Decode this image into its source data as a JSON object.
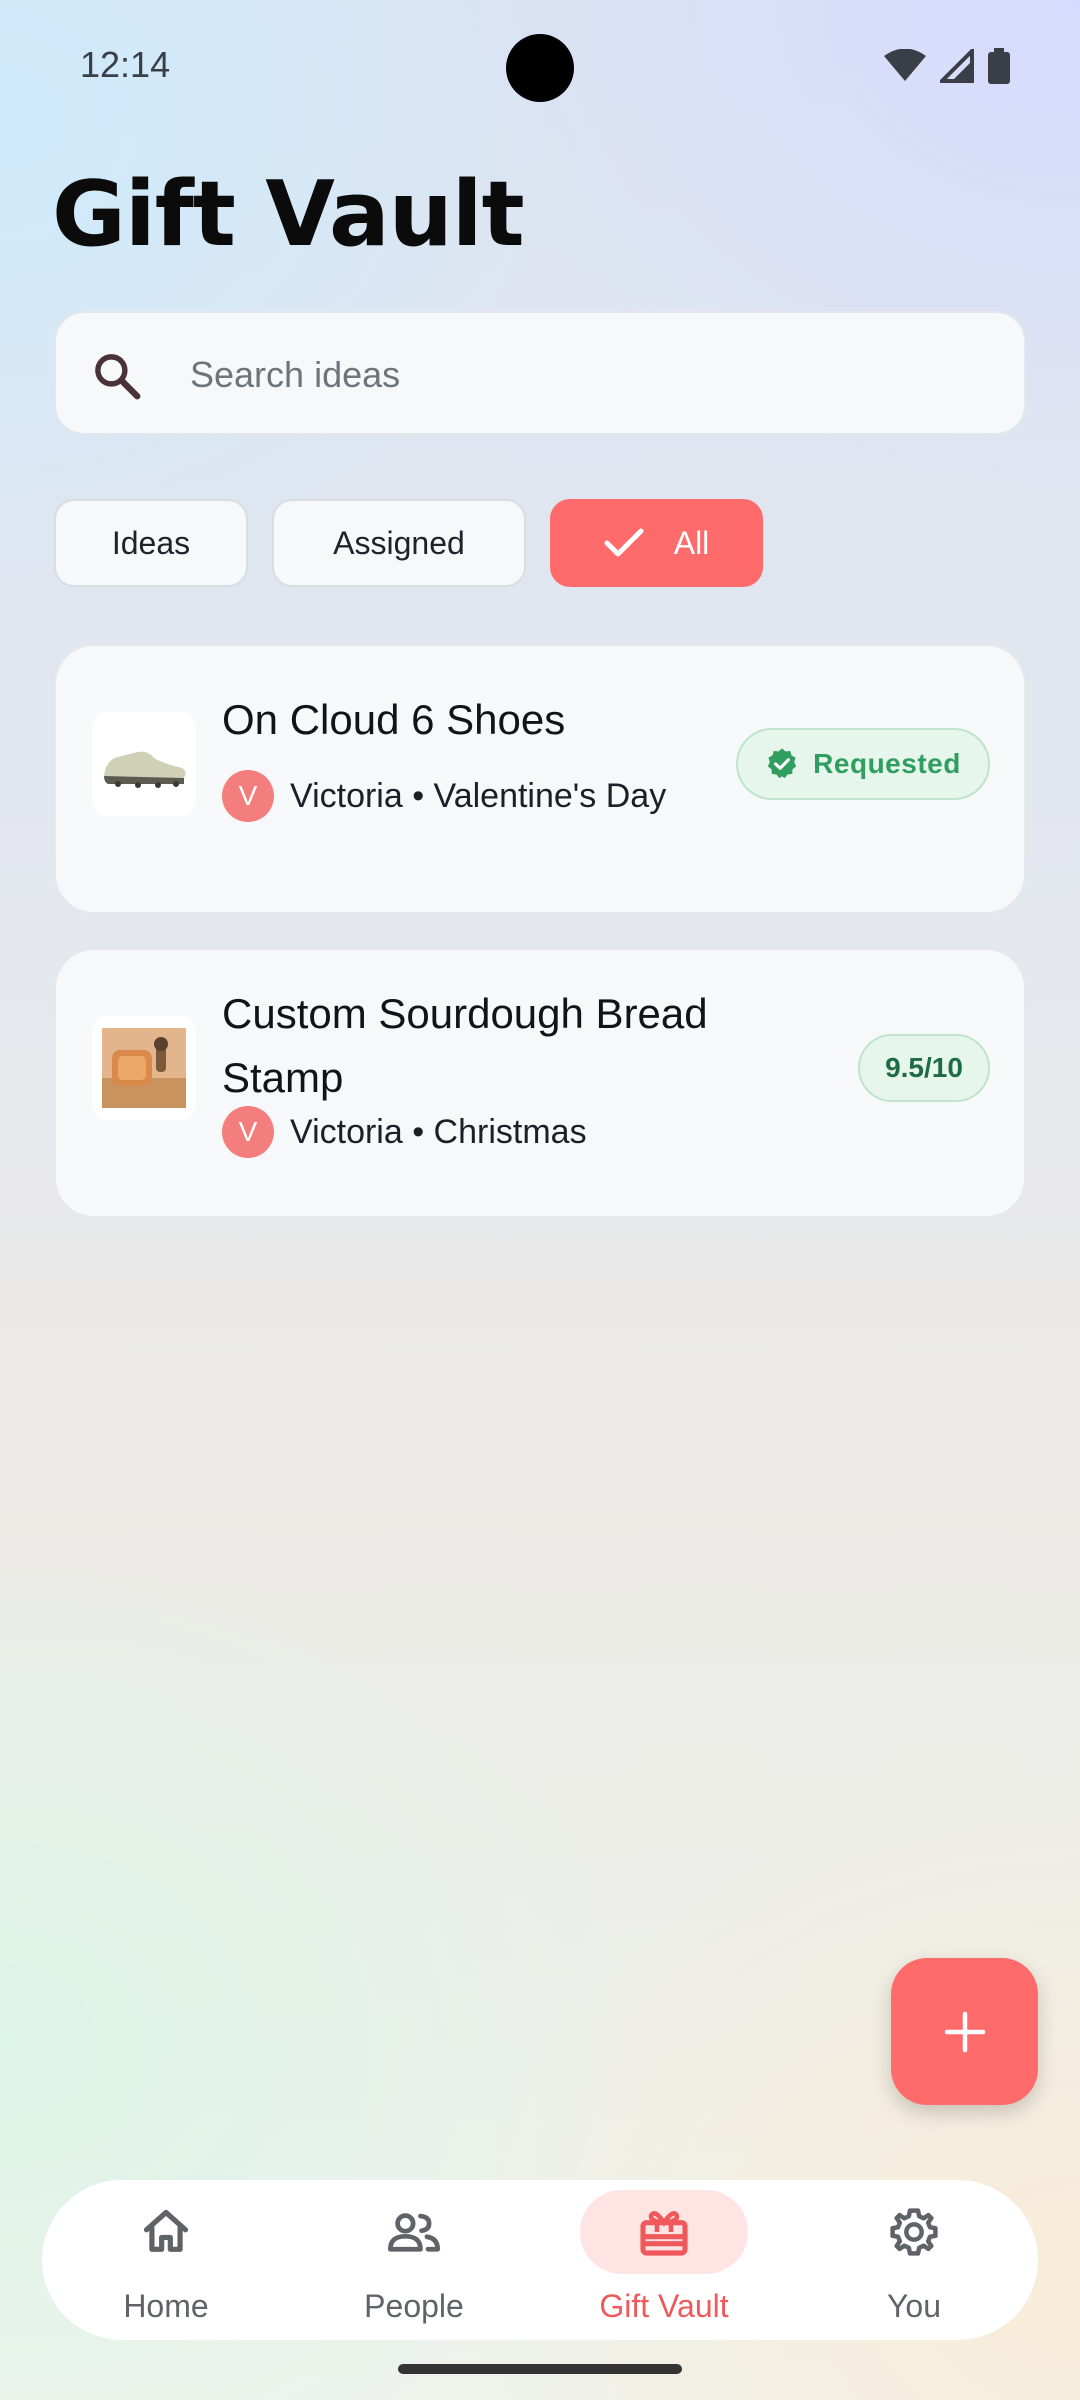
{
  "status_bar": {
    "time": "12:14"
  },
  "page": {
    "title": "Gift Vault"
  },
  "search": {
    "placeholder": "Search ideas",
    "value": ""
  },
  "filters": {
    "chips": [
      {
        "label": "Ideas",
        "selected": false
      },
      {
        "label": "Assigned",
        "selected": false
      },
      {
        "label": "All",
        "selected": true
      }
    ]
  },
  "gifts": [
    {
      "title": "On Cloud 6 Shoes",
      "avatar_initial": "V",
      "meta": "Victoria • Valentine's Day",
      "status": "Requested",
      "thumbnail": "shoe-image"
    },
    {
      "title": "Custom Sourdough Bread Stamp",
      "avatar_initial": "V",
      "meta": "Victoria • Christmas",
      "score": "9.5/10",
      "thumbnail": "bread-stamp-image"
    }
  ],
  "fab": {
    "icon": "plus-icon"
  },
  "bottom_nav": {
    "items": [
      {
        "label": "Home",
        "icon": "home-icon",
        "active": false
      },
      {
        "label": "People",
        "icon": "people-icon",
        "active": false
      },
      {
        "label": "Gift Vault",
        "icon": "gift-icon",
        "active": true
      },
      {
        "label": "You",
        "icon": "gear-icon",
        "active": false
      }
    ]
  },
  "colors": {
    "accent": "#ff6b6b",
    "success_bg": "#e7f6ec",
    "success_text": "#2f9e5e",
    "active_nav_bg": "#ffe4e4"
  }
}
